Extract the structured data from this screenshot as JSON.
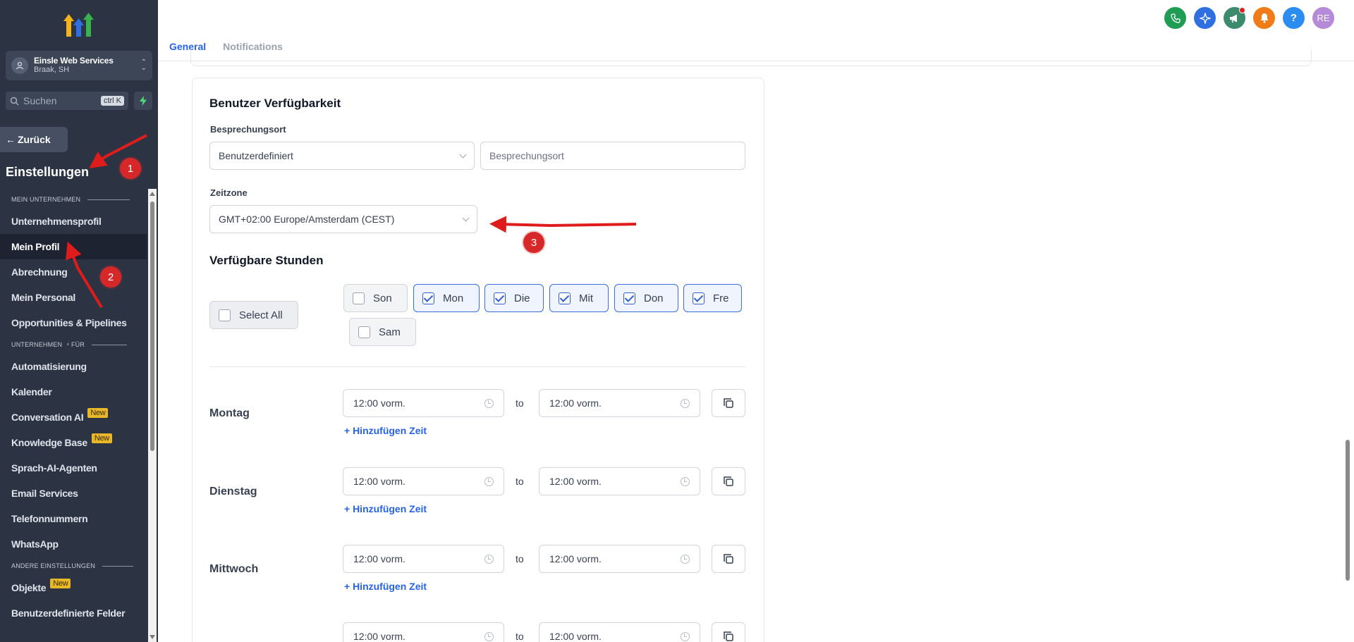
{
  "account": {
    "name": "Einsle Web Services",
    "location": "Braak, SH"
  },
  "search": {
    "placeholder": "Suchen",
    "shortcut": "ctrl K"
  },
  "nav": {
    "back_label": "Zurück",
    "settings_title": "Einstellungen",
    "section_company": "MEIN UNTERNEHMEN",
    "section_business": "UNTERNEHMEN",
    "section_business_suffix": "FÜR",
    "section_other": "ANDERE EINSTELLUNGEN",
    "new_badge": "New",
    "items": {
      "company_profile": "Unternehmensprofil",
      "my_profile": "Mein Profil",
      "billing": "Abrechnung",
      "my_staff": "Mein Personal",
      "opportunities": "Opportunities & Pipelines",
      "automation": "Automatisierung",
      "calendar": "Kalender",
      "conversation_ai": "Conversation AI",
      "knowledge_base": "Knowledge Base",
      "voice_ai": "Sprach-AI-Agenten",
      "email": "Email Services",
      "phone": "Telefonnummern",
      "whatsapp": "WhatsApp",
      "objects": "Objekte",
      "custom_fields": "Benutzerdefinierte Felder"
    }
  },
  "topbar": {
    "avatar_initials": "RE",
    "help_glyph": "?"
  },
  "tabs": {
    "general": "General",
    "notifications": "Notifications"
  },
  "availability": {
    "title": "Benutzer Verfügbarkeit",
    "meeting_location_label": "Besprechungsort",
    "meeting_location_value": "Benutzerdefiniert",
    "meeting_location_placeholder": "Besprechungsort",
    "timezone_label": "Zeitzone",
    "timezone_value": "GMT+02:00 Europe/Amsterdam (CEST)",
    "hours_title": "Verfügbare Stunden",
    "select_all": "Select All",
    "days": {
      "sun": "Son",
      "mon": "Mon",
      "tue": "Die",
      "wed": "Mit",
      "thu": "Don",
      "fri": "Fre",
      "sat": "Sam"
    },
    "to_label": "to",
    "add_time": "+ Hinzufügen Zeit",
    "slots": [
      {
        "day": "Montag",
        "from": "12:00 vorm.",
        "to": "12:00 vorm."
      },
      {
        "day": "Dienstag",
        "from": "12:00 vorm.",
        "to": "12:00 vorm."
      },
      {
        "day": "Mittwoch",
        "from": "12:00 vorm.",
        "to": "12:00 vorm."
      },
      {
        "day": "",
        "from": "12:00 vorm.",
        "to": "12:00 vorm."
      }
    ]
  },
  "annotations": {
    "n1": "1",
    "n2": "2",
    "n3": "3"
  },
  "colors": {
    "sidebar": "#2c3444",
    "accent": "#2563eb",
    "arrow": "#e01b1b",
    "badge_new": "#e8b829",
    "phone_icon": "#1f9d55",
    "ai_icon": "#2f6fe0",
    "megaphone_icon": "#3d8b6d",
    "bell_icon": "#f07b19",
    "help_icon": "#2d8cf0",
    "avatar": "#b58ad8"
  }
}
